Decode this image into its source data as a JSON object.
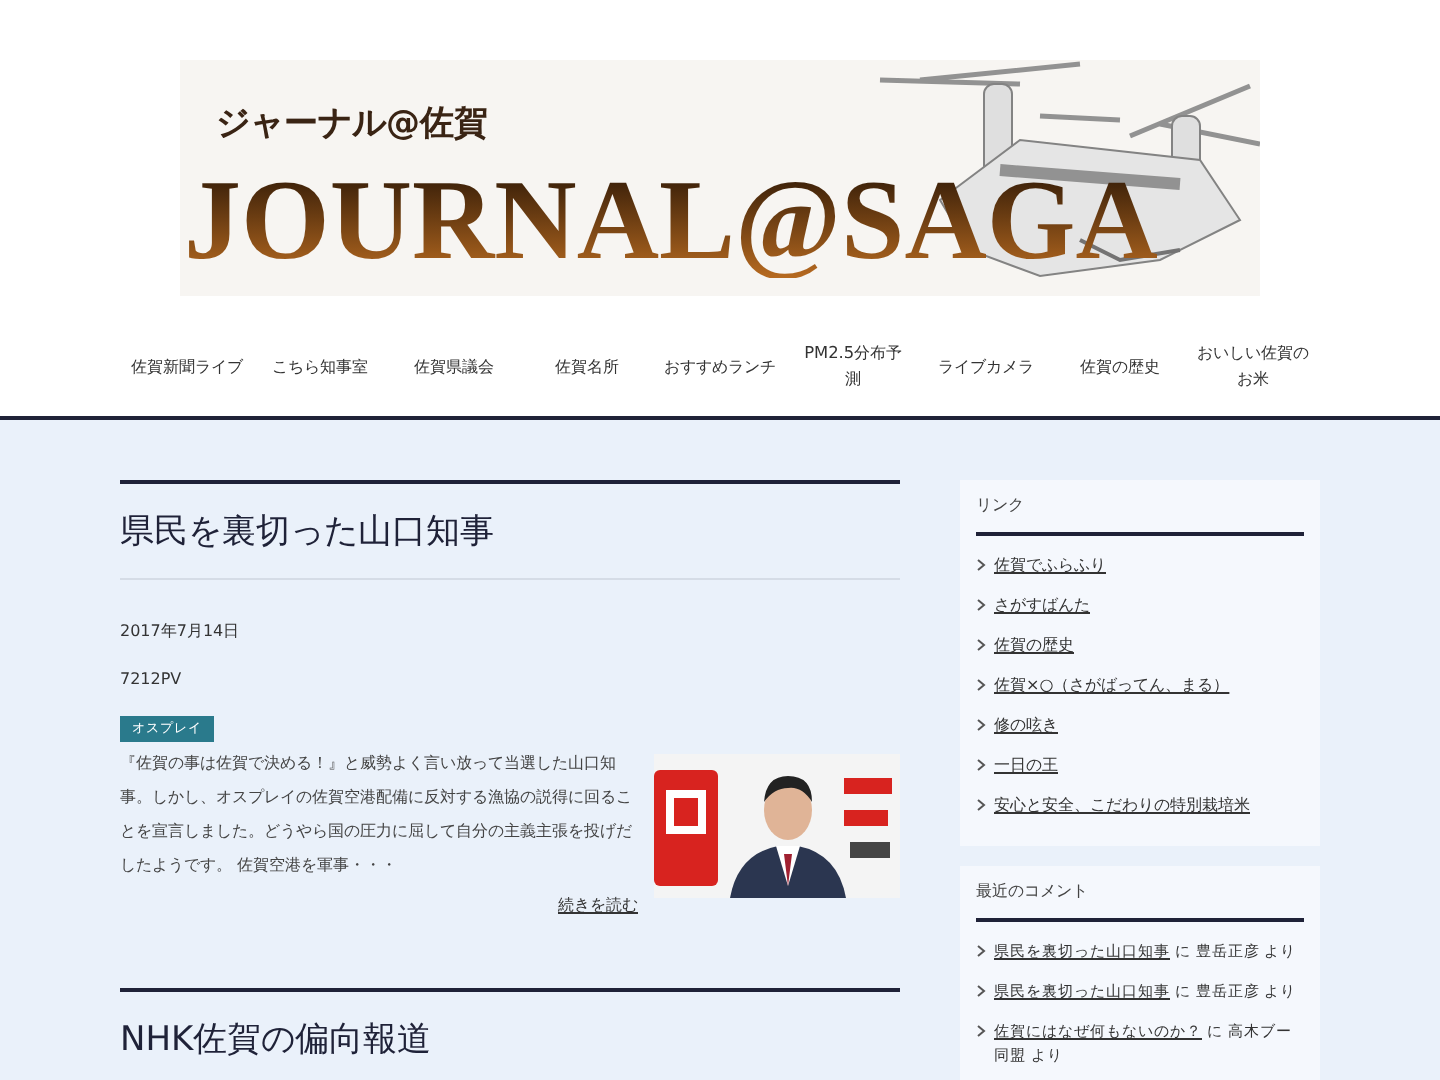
{
  "header": {
    "logo_subtitle": "ジャーナル@佐賀",
    "logo_title": "JOURNAL@SAGA"
  },
  "nav": [
    "佐賀新聞ライブ",
    "こちら知事室",
    "佐賀県議会",
    "佐賀名所",
    "おすすめランチ",
    "PM2.5分布予測",
    "ライブカメラ",
    "佐賀の歴史",
    "おいしい佐賀のお米"
  ],
  "posts": [
    {
      "title": "県民を裏切った山口知事",
      "date": "2017年7月14日",
      "views": "7212PV",
      "tag": "オスプレイ",
      "excerpt": "『佐賀の事は佐賀で決める！』と威勢よく言い放って当選した山口知事。しかし、オスプレイの佐賀空港配備に反対する漁協の説得に回ることを宣言しました。どうやら国の圧力に屈して自分の主義主張を投げだしたようです。 佐賀空港を軍事・・・",
      "more": "続きを読む"
    },
    {
      "title": "NHK佐賀の偏向報道"
    }
  ],
  "sidebar": {
    "links": {
      "title": "リンク",
      "items": [
        "佐賀でふらふり",
        "さがすばんた",
        "佐賀の歴史",
        "佐賀×○（さがばってん、まる）",
        "修の呟き",
        "一日の王",
        "安心と安全、こだわりの特別栽培米"
      ]
    },
    "comments": {
      "title": "最近のコメント",
      "items": [
        {
          "link": "県民を裏切った山口知事",
          "text": " に 豊岳正彦 より"
        },
        {
          "link": "県民を裏切った山口知事",
          "text": " に 豊岳正彦 より"
        },
        {
          "link": "佐賀にはなぜ何もないのか？",
          "text": " に 高木ブー同盟 より"
        }
      ]
    }
  }
}
